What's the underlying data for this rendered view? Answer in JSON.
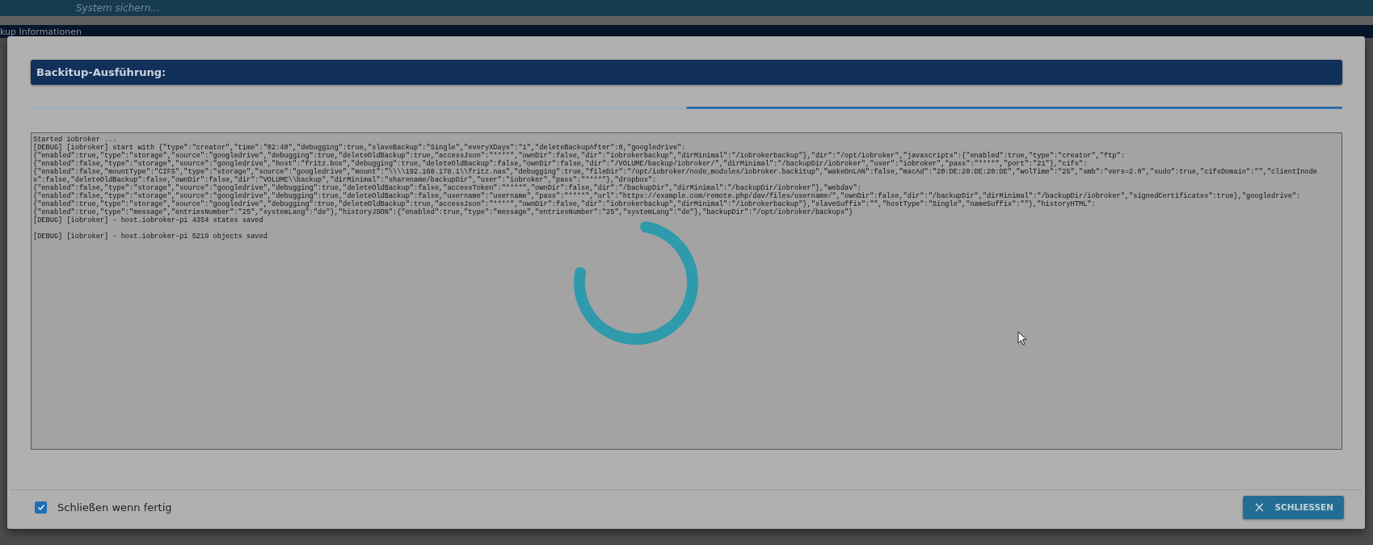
{
  "background": {
    "top_bar_title": "System sichern...",
    "section_title": "kup Informationen"
  },
  "dialog": {
    "title": "Backitup-Ausführung:",
    "log_lines": [
      "Started iobroker ...",
      "[DEBUG] [iobroker] start with {\"type\":\"creator\",\"time\":\"02:40\",\"debugging\":true,\"slaveBackup\":\"Single\",\"everyXDays\":\"1\",\"deleteBackupAfter\":0,\"googledrive\":",
      "{\"enabled\":true,\"type\":\"storage\",\"source\":\"googledrive\",\"debugging\":true,\"deleteOldBackup\":true,\"accessJson\":\"****\",\"ownDir\":false,\"dir\":\"iobrokerbackup\",\"dirMinimal\":\"/iobrokerbackup\"},\"dir\":\"/opt/iobroker\",\"javascripts\":{\"enabled\":true,\"type\":\"creator\",\"ftp\":",
      "{\"enabled\":false,\"type\":\"storage\",\"source\":\"googledrive\",\"host\":\"fritz.box\",\"debugging\":true,\"deleteOldBackup\":false,\"ownDir\":false,\"dir\":\"/VOLUME/backup/iobroker/\",\"dirMinimal\":\"/backupDir/iobroker\",\"user\":\"iobroker\",\"pass\":\"****\",\"port\":\"21\"},\"cifs\":",
      "{\"enabled\":false,\"mountType\":\"CIFS\",\"type\":\"storage\",\"source\":\"googledrive\",\"mount\":\"\\\\\\\\192.168.178.1\\\\fritz.nas\",\"debugging\":true,\"fileDir\":\"/opt/iobroker/node_modules/iobroker.backitup\",\"wakeOnLAN\":false,\"macAd\":\"20:DE:20:DE:20:DE\",\"wolTime\":\"25\",\"smb\":\"vers=2.0\",\"sudo\":true,\"cifsDomain\":\"\",\"clientInode",
      "s\":false,\"deleteOldBackup\":false,\"ownDir\":false,\"dir\":\"VOLUME\\\\backup\",\"dirMinimal\":\"sharename/backupDir\",\"user\":\"iobroker\",\"pass\":\"****\"},\"dropbox\":",
      "{\"enabled\":false,\"type\":\"storage\",\"source\":\"googledrive\",\"debugging\":true,\"deleteOldBackup\":false,\"accessToken\":\"****\",\"ownDir\":false,\"dir\":\"/backupDir\",\"dirMinimal\":\"/backupDir/iobroker\"},\"webdav\":",
      "{\"enabled\":false,\"type\":\"storage\",\"source\":\"googledrive\",\"debugging\":true,\"deleteOldBackup\":false,\"username\":\"username\",\"pass\":\"****\",\"url\":\"https://example.com/remote.php/dav/files/username/\",\"ownDir\":false,\"dir\":\"/backupDir\",\"dirMinimal\":\"/backupDir/iobroker\",\"signedCertificates\":true},\"googledrive\":",
      "{\"enabled\":true,\"type\":\"storage\",\"source\":\"googledrive\",\"debugging\":true,\"deleteOldBackup\":true,\"accessJson\":\"****\",\"ownDir\":false,\"dir\":\"iobrokerbackup\",\"dirMinimal\":\"/iobrokerbackup\"},\"slaveSuffix\":\"\",\"hostType\":\"Single\",\"nameSuffix\":\"\"},\"historyHTML\":",
      "{\"enabled\":true,\"type\":\"message\",\"entriesNumber\":\"25\",\"systemLang\":\"de\"},\"historyJSON\":{\"enabled\":true,\"type\":\"message\",\"entriesNumber\":\"25\",\"systemLang\":\"de\"},\"backupDir\":\"/opt/iobroker/backups\"}",
      "[DEBUG] [iobroker] - host.iobroker-pi 4354 states saved",
      "[DEBUG] [iobroker] - host.iobroker-pi 5219 objects saved"
    ],
    "close_when_done": {
      "label": "Schließen wenn fertig",
      "checked": true
    },
    "close_button": {
      "icon": "×",
      "label": "SCHLIESSEN"
    }
  }
}
